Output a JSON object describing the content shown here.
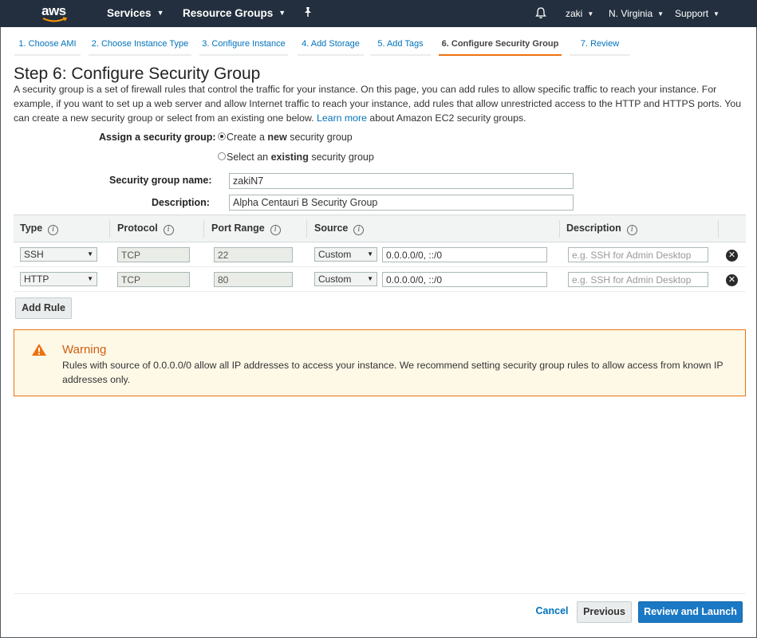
{
  "topnav": {
    "logo": "aws",
    "services": "Services",
    "resource_groups": "Resource Groups",
    "pin_icon": "pin-icon",
    "bell_icon": "bell-icon",
    "user": "zaki",
    "region": "N. Virginia",
    "support": "Support"
  },
  "wizard": {
    "tabs": [
      {
        "label": "1. Choose AMI"
      },
      {
        "label": "2. Choose Instance Type"
      },
      {
        "label": "3. Configure Instance"
      },
      {
        "label": "4. Add Storage"
      },
      {
        "label": "5. Add Tags"
      },
      {
        "label": "6. Configure Security Group",
        "active": true
      },
      {
        "label": "7. Review"
      }
    ]
  },
  "page": {
    "title": "Step 6: Configure Security Group",
    "intro_text": "A security group is a set of firewall rules that control the traffic for your instance. On this page, you can add rules to allow specific traffic to reach your instance. For example, if you want to set up a web server and allow Internet traffic to reach your instance, add rules that allow unrestricted access to the HTTP and HTTPS ports. You can create a new security group or select from an existing one below.",
    "learn_more": "Learn more",
    "intro_tail": "about Amazon EC2 security groups."
  },
  "form": {
    "assign_label": "Assign a security group:",
    "option_create_pre": "Create a ",
    "option_create_bold": "new",
    "option_create_post": " security group",
    "option_select_pre": "Select an ",
    "option_select_bold": "existing",
    "option_select_post": " security group",
    "selected_option": "create",
    "name_label": "Security group name:",
    "name_value": "zakiN7",
    "desc_label": "Description:",
    "desc_value": "Alpha Centauri B Security Group"
  },
  "rules": {
    "headers": {
      "type": "Type",
      "protocol": "Protocol",
      "port_range": "Port Range",
      "source": "Source",
      "description": "Description"
    },
    "rows": [
      {
        "type": "SSH",
        "protocol": "TCP",
        "port_range": "22",
        "source_type": "Custom",
        "source_cidr": "0.0.0.0/0, ::/0",
        "description_placeholder": "e.g. SSH for Admin Desktop"
      },
      {
        "type": "HTTP",
        "protocol": "TCP",
        "port_range": "80",
        "source_type": "Custom",
        "source_cidr": "0.0.0.0/0, ::/0",
        "description_placeholder": "e.g. SSH for Admin Desktop"
      }
    ],
    "add_rule": "Add Rule"
  },
  "warning": {
    "title": "Warning",
    "text": "Rules with source of 0.0.0.0/0 allow all IP addresses to access your instance. We recommend setting security group rules to allow access from known IP addresses only."
  },
  "footer": {
    "cancel": "Cancel",
    "previous": "Previous",
    "review_launch": "Review and Launch"
  },
  "colors": {
    "nav_bg": "#232f3e",
    "link": "#0073bb",
    "active_tab": "#ec7211",
    "primary_button": "#1b78c4",
    "warning_border": "#ec7211",
    "warning_bg": "#fef8e7"
  }
}
